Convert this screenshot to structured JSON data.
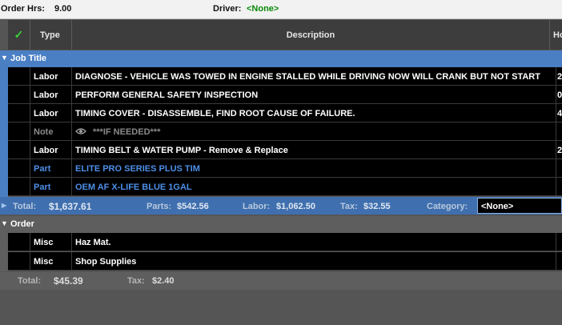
{
  "topbar": {
    "order_hrs_label": "Order Hrs:",
    "order_hrs_value": "9.00",
    "driver_label": "Driver:",
    "driver_value": "<None>",
    "driver_value_color": "#0a8a0a"
  },
  "columns": {
    "check_icon": "✓",
    "type": "Type",
    "description": "Description",
    "hours": "Ho"
  },
  "job": {
    "title": "Job Title",
    "rows": [
      {
        "type": "Labor",
        "description": "DIAGNOSE - VEHICLE WAS TOWED IN ENGINE STALLED WHILE DRIVING NOW WILL CRANK BUT NOT START",
        "hours": "2",
        "kind": "labor"
      },
      {
        "type": "Labor",
        "description": "PERFORM GENERAL SAFETY INSPECTION",
        "hours": "0",
        "kind": "labor"
      },
      {
        "type": "Labor",
        "description": "TIMING COVER - DISASSEMBLE, FIND ROOT CAUSE OF FAILURE.",
        "hours": "4",
        "kind": "labor"
      },
      {
        "type": "Note",
        "description": "***IF NEEDED***",
        "hours": "",
        "kind": "note",
        "icon": "eye-icon"
      },
      {
        "type": "Labor",
        "description": "TIMING BELT & WATER PUMP - Remove & Replace",
        "hours": "2",
        "kind": "labor"
      },
      {
        "type": "Part",
        "description": "ELITE PRO SERIES PLUS TIM",
        "hours": "",
        "kind": "part"
      },
      {
        "type": "Part",
        "description": "OEM AF X-LIFE BLUE 1GAL",
        "hours": "",
        "kind": "part"
      }
    ],
    "totals": {
      "total_label": "Total:",
      "total_value": "$1,637.61",
      "parts_label": "Parts:",
      "parts_value": "$542.56",
      "labor_label": "Labor:",
      "labor_value": "$1,062.50",
      "tax_label": "Tax:",
      "tax_value": "$32.55",
      "category_label": "Category:",
      "category_value": "<None>"
    }
  },
  "order": {
    "title": "Order",
    "rows": [
      {
        "type": "Misc",
        "description": "Haz Mat."
      },
      {
        "type": "Misc",
        "description": "Shop Supplies"
      }
    ],
    "totals": {
      "total_label": "Total:",
      "total_value": "$45.39",
      "tax_label": "Tax:",
      "tax_value": "$2.40"
    }
  },
  "colors": {
    "job_accent": "#4a7fc4",
    "part_text": "#4d8fe8",
    "check_green": "#3bd13b"
  }
}
